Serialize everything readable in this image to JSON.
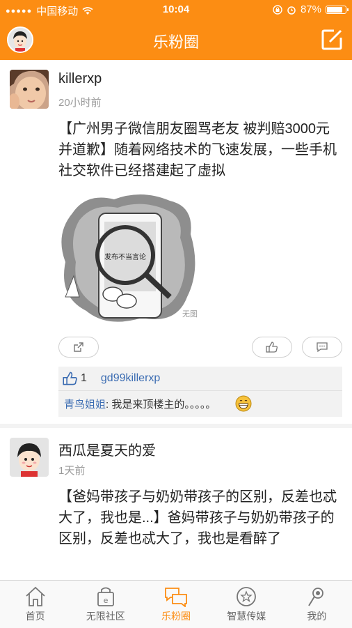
{
  "status_bar": {
    "carrier": "中国移动",
    "time": "10:04",
    "battery": "87%"
  },
  "nav": {
    "title": "乐粉圈"
  },
  "posts": [
    {
      "username": "killerxp",
      "time": "20小时前",
      "content": "【广州男子微信朋友圈骂老友 被判赔3000元并道歉】随着网络技术的飞速发展，一些手机社交软件已经搭建起了虚拟",
      "image_caption": "发布不当言论",
      "watermark": "无图",
      "like_count": "1",
      "likers": "gd99killerxp",
      "comment_author": "青鸟姐姐",
      "comment_text": ": 我是来顶楼主的。。。。。"
    },
    {
      "username": "西瓜是夏天的爱",
      "time": "1天前",
      "content": "【爸妈带孩子与奶奶带孩子的区别，反差也忒大了，我也是...】爸妈带孩子与奶奶带孩子的区别，反差也忒大了，我也是看醉了"
    }
  ],
  "tabs": [
    {
      "label": "首页",
      "icon": "home-icon"
    },
    {
      "label": "无限社区",
      "icon": "community-icon"
    },
    {
      "label": "乐粉圈",
      "icon": "chat-bubbles-icon"
    },
    {
      "label": "智慧传媒",
      "icon": "star-circle-icon"
    },
    {
      "label": "我的",
      "icon": "profile-icon"
    }
  ],
  "colors": {
    "accent": "#fc8d13",
    "link": "#3b6cb2"
  }
}
